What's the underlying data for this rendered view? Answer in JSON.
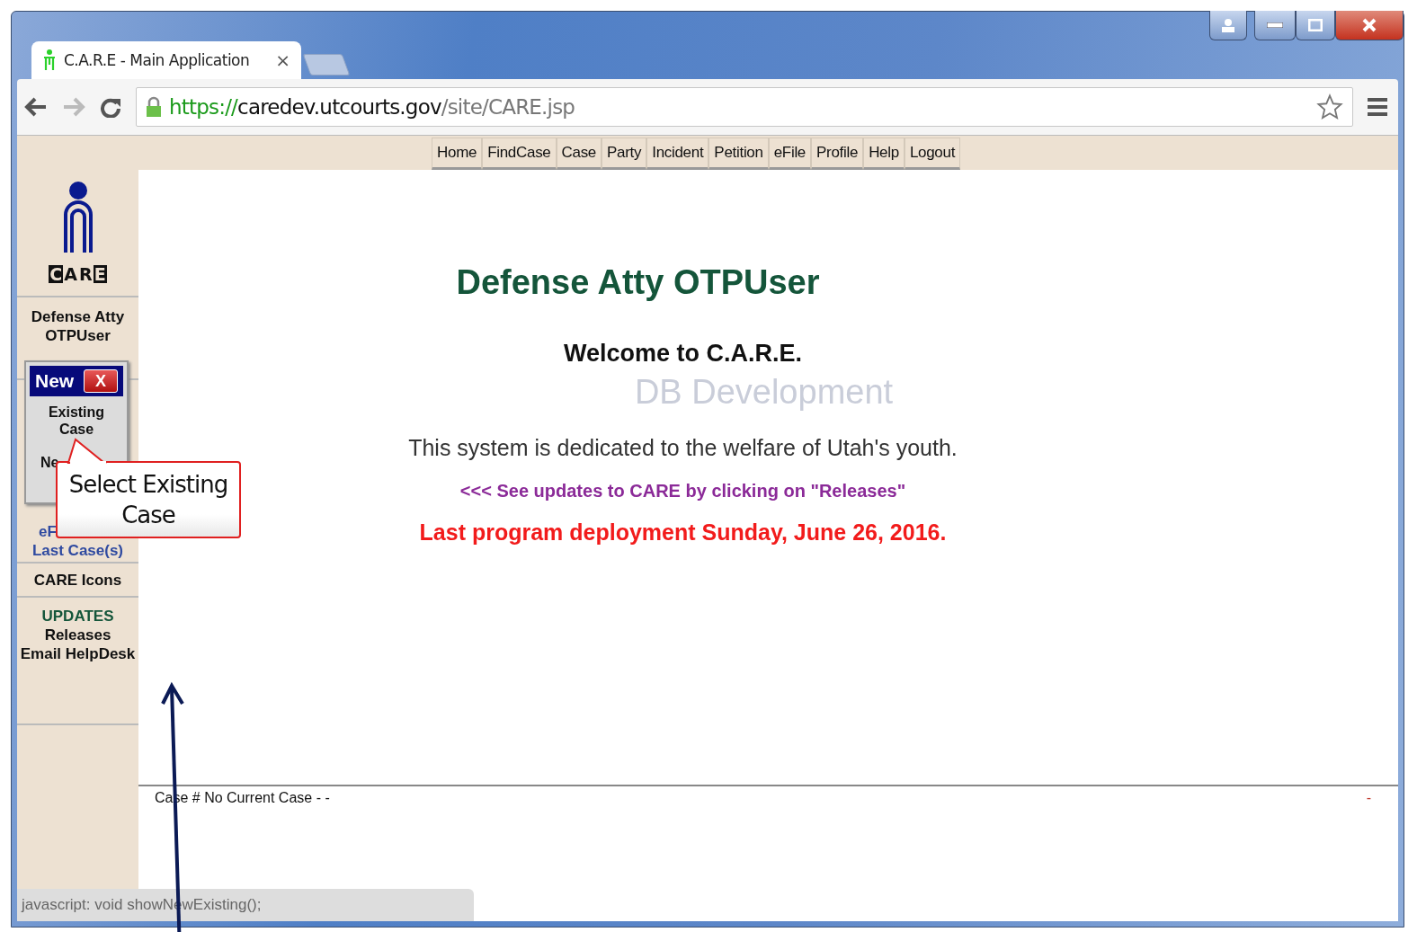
{
  "browser": {
    "tab": {
      "title": "C.A.R.E - Main Application",
      "close": "×"
    },
    "url": {
      "scheme": "https://",
      "host": "caredev.utcourts.gov",
      "path": "/site/CARE.jsp"
    }
  },
  "nav": [
    {
      "label": "Home"
    },
    {
      "label": "FindCase"
    },
    {
      "label": "Case"
    },
    {
      "label": "Party"
    },
    {
      "label": "Incident"
    },
    {
      "label": "Petition"
    },
    {
      "label": "eFile"
    },
    {
      "label": "Profile"
    },
    {
      "label": "Help"
    },
    {
      "label": "Logout"
    }
  ],
  "sidebar": {
    "logo_text": "CARE",
    "user": "Defense Atty OTPUser",
    "efile": "eF",
    "last_cases": "Last Case(s)",
    "care_icons": "CARE Icons",
    "updates_heading": "UPDATES",
    "links": [
      "Releases",
      "Email HelpDesk"
    ]
  },
  "popup": {
    "title": "New",
    "close": "X",
    "options": [
      "Existing Case",
      "Ne"
    ]
  },
  "callout": "Select Existing Case",
  "main": {
    "user_title": "Defense Atty OTPUser",
    "welcome": "Welcome to C.A.R.E.",
    "environment": "DB Development",
    "mission": "This system is dedicated to the welfare of Utah's youth.",
    "updates_hint": "<<< See updates to CARE by clicking on \"Releases\"",
    "deployment": "Last program deployment Sunday, June 26, 2016."
  },
  "footer": {
    "case": "Case # No Current Case - -",
    "right": "-"
  },
  "status_url": "javascript: void showNewExisting();"
}
